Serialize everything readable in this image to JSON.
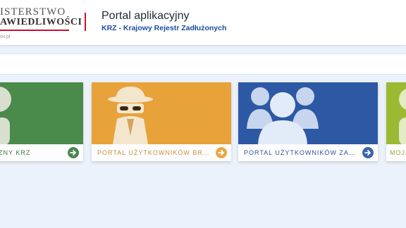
{
  "header": {
    "logo_line1": "ISTERSTWO",
    "logo_line2": "AWIEDLIWOŚCI",
    "logo_url": "ov.pl",
    "portal_title": "Portal aplikacyjny",
    "portal_subtitle": "KRZ - Krajowy Rejestr Zadłużonych"
  },
  "tiles": [
    {
      "label": "ZNY KRZ",
      "color": "#4a8a4b",
      "label_color": "#2f6b30",
      "icon": "user-icon"
    },
    {
      "label": "PORTAL UŻYTKOWNIKÓW BRANŻ…",
      "color": "#e8a23a",
      "label_color": "#c7892c",
      "icon": "spy-icon"
    },
    {
      "label": "PORTAL UŻYTKOWNIKÓW ZAREJE…",
      "color": "#2d59a4",
      "label_color": "#23478a",
      "icon": "users-group-icon"
    },
    {
      "label": "MOJA",
      "color": "#9cb933",
      "label_color": "#8aa52a",
      "icon": "user-icon"
    }
  ],
  "colors": {
    "accent": "#c8102e",
    "brand": "#1a4d9c"
  }
}
